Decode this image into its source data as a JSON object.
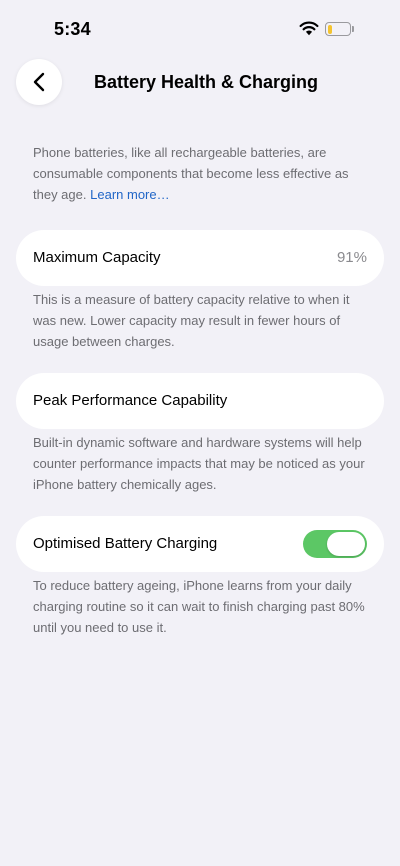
{
  "status_bar": {
    "time": "5:34",
    "battery_level": 0.2,
    "battery_color": "#f4c430",
    "wifi_icon": "wifi-icon"
  },
  "nav": {
    "back_icon": "chevron-left-icon",
    "title": "Battery Health & Charging"
  },
  "intro": {
    "text": "Phone batteries, like all rechargeable batteries, are consumable components that become less effective as they age.",
    "link": "Learn more…"
  },
  "maximum_capacity": {
    "label": "Maximum Capacity",
    "value": "91%",
    "description": "This is a measure of battery capacity relative to when it was new. Lower capacity may result in fewer hours of usage between charges."
  },
  "peak_performance": {
    "label": "Peak Performance Capability",
    "description": "Built-in dynamic software and hardware systems will help counter performance impacts that may be noticed as your iPhone battery chemically ages."
  },
  "optimised_charging": {
    "label": "Optimised Battery Charging",
    "enabled": true,
    "toggle_color": "#5cc765",
    "description": "To reduce battery ageing, iPhone learns from your daily charging routine so it can wait to finish charging past 80% until you need to use it."
  }
}
